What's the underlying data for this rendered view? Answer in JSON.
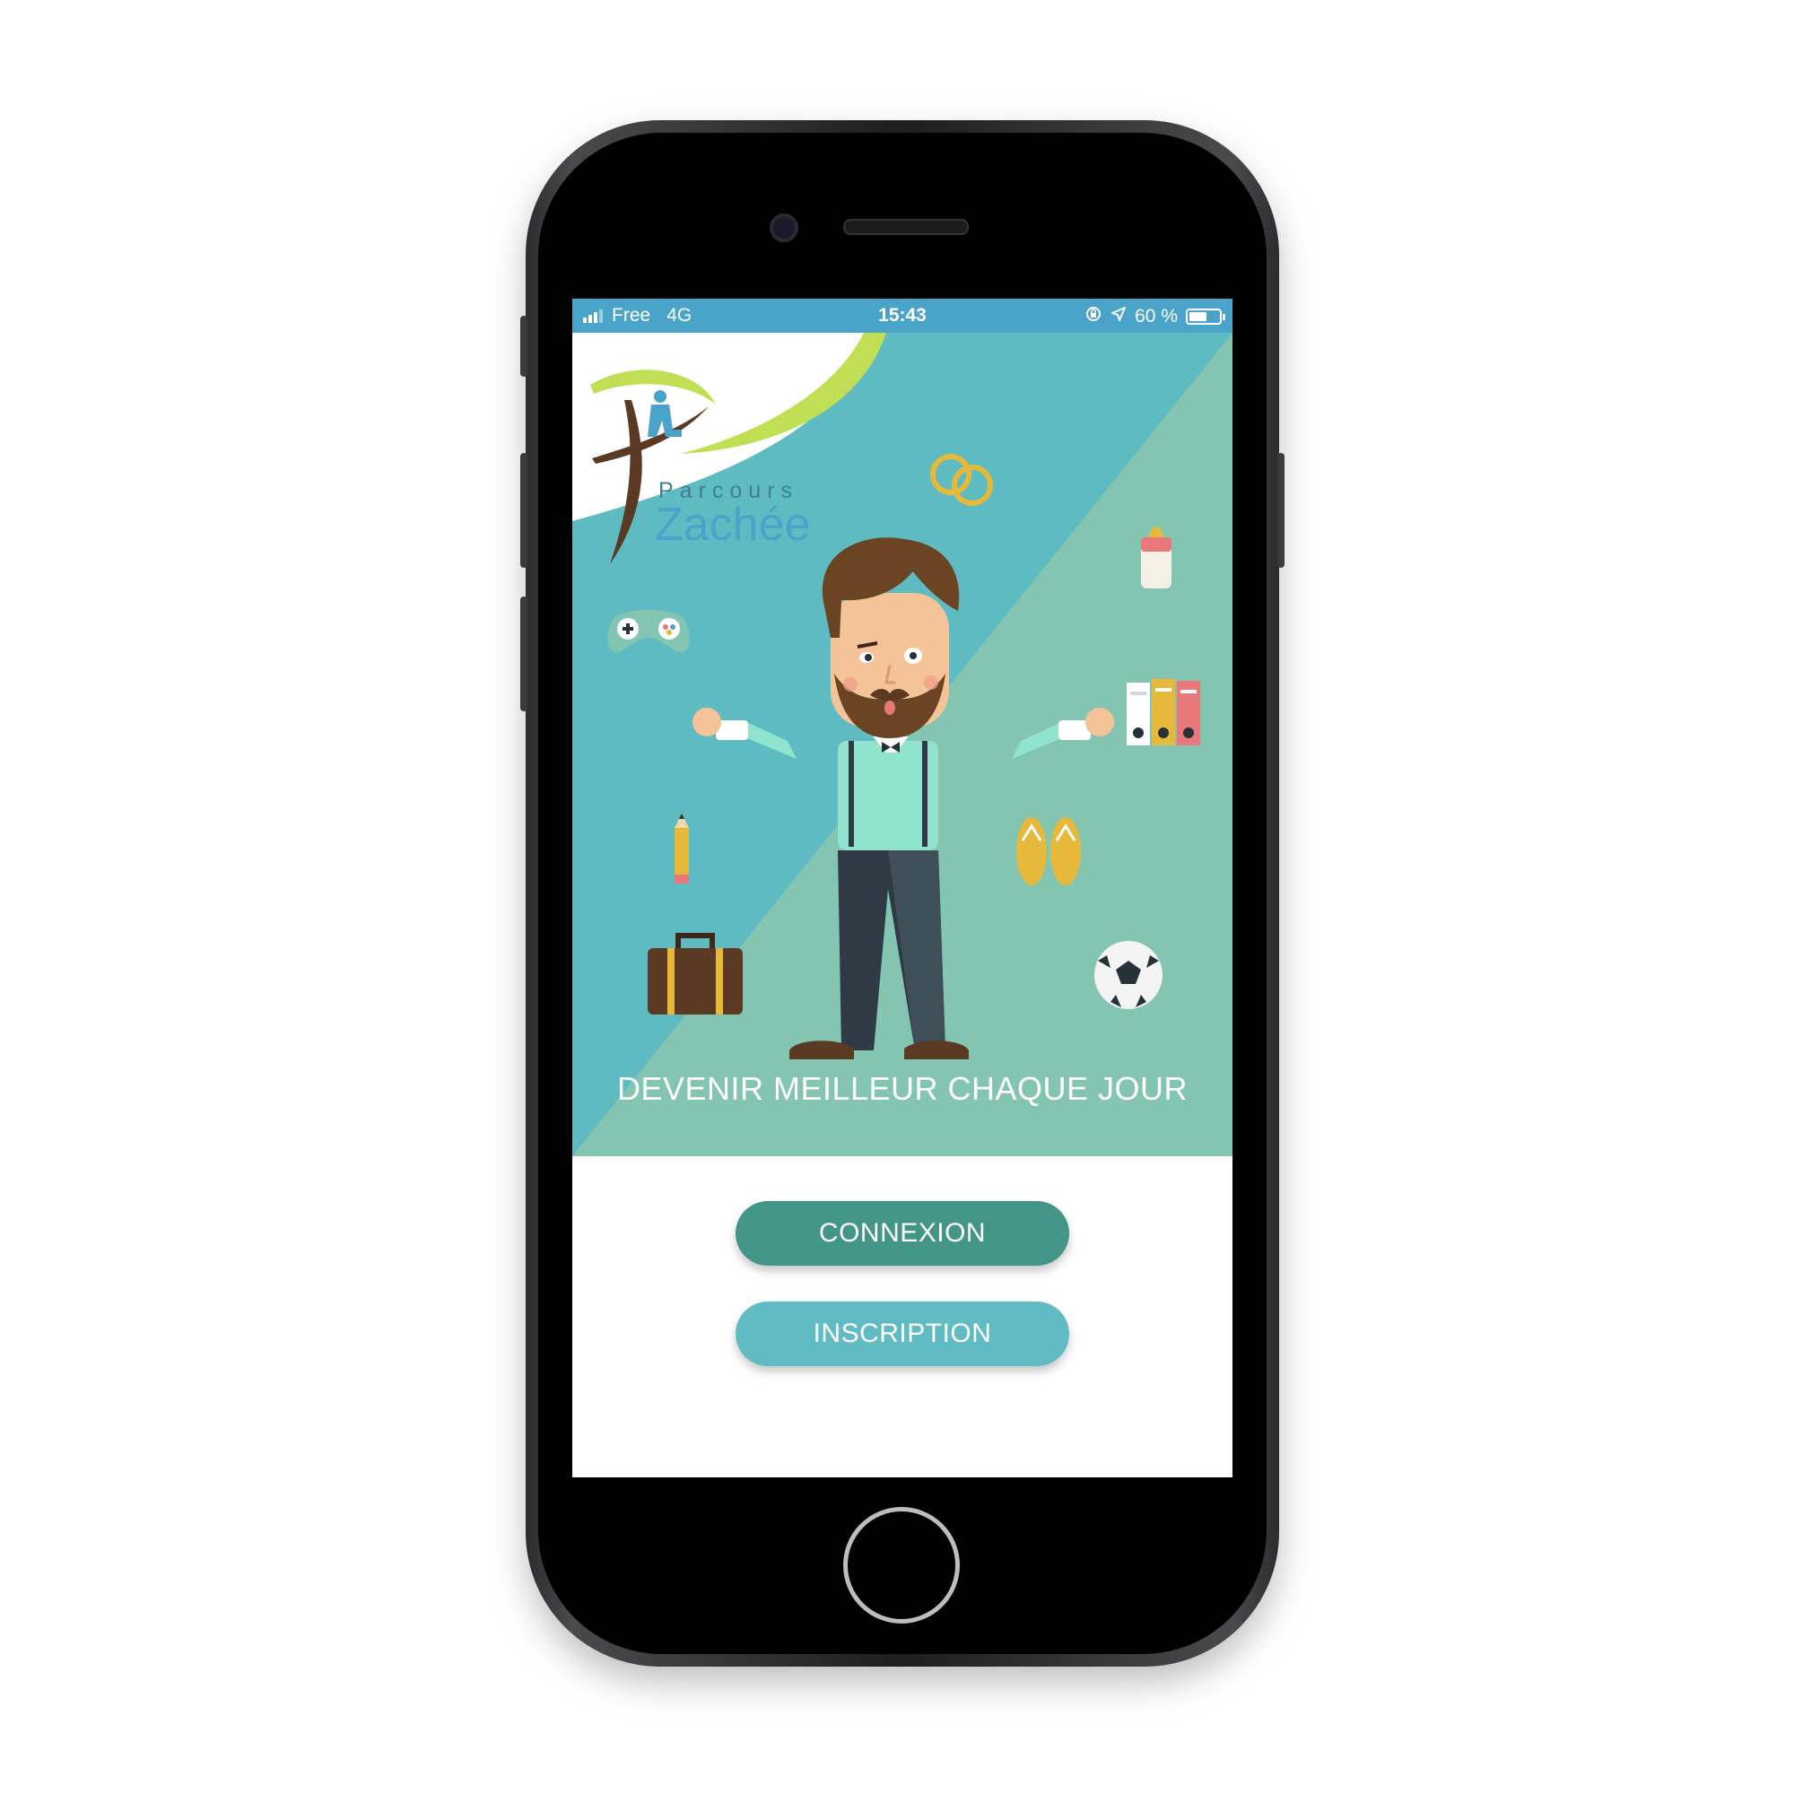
{
  "status_bar": {
    "carrier": "Free",
    "network": "4G",
    "time": "15:43",
    "battery": "60 %",
    "battery_level": 0.6,
    "icons": [
      "signal-icon",
      "orientation-lock-icon",
      "location-arrow-icon",
      "battery-icon"
    ]
  },
  "logo": {
    "line1": "Parcours",
    "line2": "Zachée"
  },
  "hero": {
    "tagline": "DEVENIR MEILLEUR CHAQUE JOUR",
    "icons": [
      "wedding-rings-icon",
      "baby-bottle-icon",
      "game-controller-icon",
      "binders-icon",
      "pencil-icon",
      "flip-flops-icon",
      "briefcase-icon",
      "soccer-ball-icon",
      "man-illustration"
    ]
  },
  "buttons": {
    "connexion": "CONNEXION",
    "inscription": "INSCRIPTION"
  },
  "colors": {
    "status_bar": "#4aa3c9",
    "hero_dark": "#5fbbc2",
    "hero_light": "#84c5b2",
    "connexion": "#439586",
    "inscription": "#61bbc3",
    "logo_green": "#c1df55"
  }
}
